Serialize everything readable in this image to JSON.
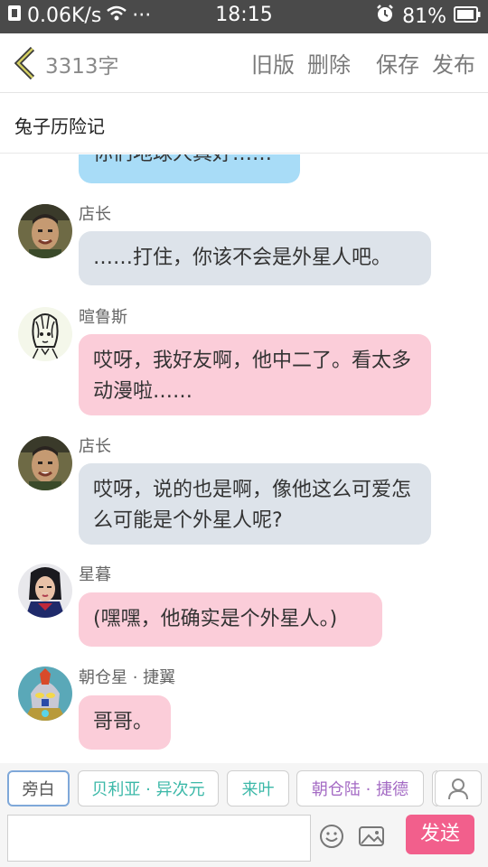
{
  "status_bar": {
    "net_speed": "0.06K/s",
    "dots": "···",
    "time": "18:15",
    "battery": "81%"
  },
  "top_bar": {
    "word_count": "3313字",
    "actions": [
      "旧版",
      "删除",
      "保存",
      "发布"
    ]
  },
  "story": {
    "title": "兔子历险记"
  },
  "messages": [
    {
      "name": "",
      "text": "你们地球人真好……",
      "color": "blue"
    },
    {
      "name": "店长",
      "text": "……打住，你该不会是外星人吧。",
      "color": "gray"
    },
    {
      "name": "暄鲁斯",
      "text": "哎呀，我好友啊，他中二了。看太多动漫啦……",
      "color": "pink"
    },
    {
      "name": "店长",
      "text": "哎呀，说的也是啊，像他这么可爱怎么可能是个外星人呢?",
      "color": "gray"
    },
    {
      "name": "星暮",
      "text": "(嘿嘿，他确实是个外星人。)",
      "color": "pink"
    },
    {
      "name": "朝仓星 · 捷翼",
      "text": "哥哥。",
      "color": "pink"
    }
  ],
  "characters": [
    "旁白",
    "贝利亚 · 异次元",
    "来叶",
    "朝仓陆 · 捷德"
  ],
  "input": {
    "placeholder": "",
    "send_label": "发送"
  },
  "colors": {
    "bubble_blue": "#a8dcf7",
    "bubble_gray": "#dde3ea",
    "bubble_pink": "#fbcdd9",
    "send_button": "#f25f8c"
  }
}
